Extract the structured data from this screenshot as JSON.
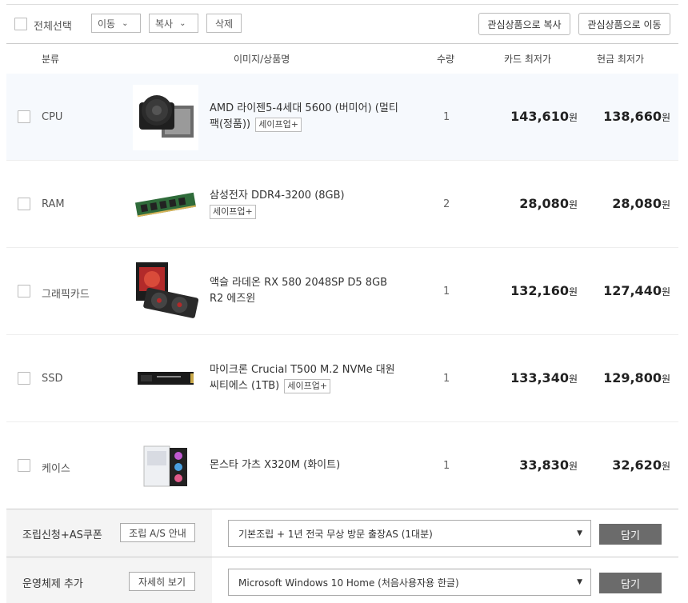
{
  "toolbar": {
    "select_all_label": "전체선택",
    "move_label": "이동",
    "copy_label": "복사",
    "delete_label": "삭제",
    "copy_to_wishlist_label": "관심상품으로 복사",
    "move_to_wishlist_label": "관심상품으로 이동"
  },
  "table": {
    "headers": [
      "분류",
      "이미지/상품명",
      "수량",
      "카드 최저가",
      "현금 최저가"
    ],
    "currency": "원",
    "rows": [
      {
        "category": "CPU",
        "name": "AMD 라이젠5-4세대 5600 (버미어) (멀티팩(정품))",
        "badge": "세이프업+",
        "qty": "1",
        "card_price": "143,610",
        "cash_price": "138,660",
        "image": "cpu-cooler-image"
      },
      {
        "category": "RAM",
        "name": "삼성전자 DDR4-3200 (8GB)",
        "badge": "세이프업+",
        "qty": "2",
        "card_price": "28,080",
        "cash_price": "28,080",
        "image": "ram-stick-image"
      },
      {
        "category": "그래픽카드",
        "name": "액슬 라데온 RX 580 2048SP D5 8GB R2 에즈윈",
        "badge": "",
        "qty": "1",
        "card_price": "132,160",
        "cash_price": "127,440",
        "image": "graphics-card-image"
      },
      {
        "category": "SSD",
        "name": "마이크론 Crucial T500 M.2 NVMe 대원씨티에스 (1TB)",
        "badge": "세이프업+",
        "qty": "1",
        "card_price": "133,340",
        "cash_price": "129,800",
        "image": "ssd-image"
      },
      {
        "category": "케이스",
        "name": "몬스타 가츠 X320M (화이트)",
        "badge": "",
        "qty": "1",
        "card_price": "33,830",
        "cash_price": "32,620",
        "image": "pc-case-image"
      }
    ]
  },
  "options": [
    {
      "label": "조립신청+AS쿠폰",
      "info_button": "조립 A/S 안내",
      "selected": "기본조립 + 1년 전국 무상 방문 출장AS (1대분)",
      "add_button": "담기"
    },
    {
      "label": "운영체제 추가",
      "info_button": "자세히 보기",
      "selected": "Microsoft Windows 10 Home (처음사용자용 한글)",
      "add_button": "담기"
    }
  ],
  "colors": {
    "row_highlight": "#f6f9fd",
    "add_button": "#6b6b6b"
  }
}
